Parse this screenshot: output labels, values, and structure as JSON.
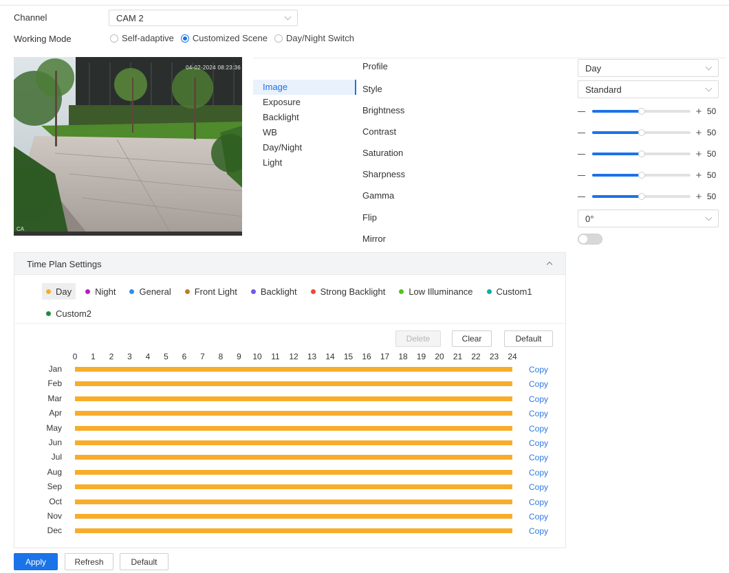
{
  "colors": {
    "accent": "#1a73e8",
    "link": "#2d78e0",
    "plan_bar": "#f7ad2b"
  },
  "channel": {
    "label": "Channel",
    "value": "CAM 2"
  },
  "working_mode": {
    "label": "Working Mode",
    "options": [
      {
        "label": "Self-adaptive",
        "selected": false
      },
      {
        "label": "Customized Scene",
        "selected": true
      },
      {
        "label": "Day/Night Switch",
        "selected": false
      }
    ]
  },
  "preview": {
    "timestamp": "04-02-2024 08:23:36",
    "corner": "CA"
  },
  "menu": {
    "items": [
      "Image",
      "Exposure",
      "Backlight",
      "WB",
      "Day/Night",
      "Light"
    ],
    "active_index": 0
  },
  "properties": {
    "profile": {
      "label": "Profile",
      "value": "Day"
    },
    "style": {
      "label": "Style",
      "value": "Standard"
    },
    "sliders": [
      {
        "label": "Brightness",
        "value": 50
      },
      {
        "label": "Contrast",
        "value": 50
      },
      {
        "label": "Saturation",
        "value": 50
      },
      {
        "label": "Sharpness",
        "value": 50
      },
      {
        "label": "Gamma",
        "value": 50
      }
    ],
    "slider_max": 100,
    "flip": {
      "label": "Flip",
      "value": "0°"
    },
    "mirror": {
      "label": "Mirror",
      "on": false
    }
  },
  "time_plan": {
    "title": "Time Plan Settings",
    "legend": [
      {
        "label": "Day",
        "color": "#f7ad2b",
        "active": true
      },
      {
        "label": "Night",
        "color": "#b21fbf",
        "active": false
      },
      {
        "label": "General",
        "color": "#2a8ff0",
        "active": false
      },
      {
        "label": "Front Light",
        "color": "#b8811c",
        "active": false
      },
      {
        "label": "Backlight",
        "color": "#6c5ce7",
        "active": false
      },
      {
        "label": "Strong Backlight",
        "color": "#ea4a34",
        "active": false
      },
      {
        "label": "Low Illuminance",
        "color": "#52c41a",
        "active": false
      },
      {
        "label": "Custom1",
        "color": "#13a8a8",
        "active": false
      },
      {
        "label": "Custom2",
        "color": "#1e8e3e",
        "active": false
      }
    ],
    "buttons": {
      "delete": "Delete",
      "clear": "Clear",
      "default": "Default"
    },
    "hours": [
      "0",
      "1",
      "2",
      "3",
      "4",
      "5",
      "6",
      "7",
      "8",
      "9",
      "10",
      "11",
      "12",
      "13",
      "14",
      "15",
      "16",
      "17",
      "18",
      "19",
      "20",
      "21",
      "22",
      "23",
      "24"
    ],
    "months": [
      "Jan",
      "Feb",
      "Mar",
      "Apr",
      "May",
      "Jun",
      "Jul",
      "Aug",
      "Sep",
      "Oct",
      "Nov",
      "Dec"
    ],
    "copy_label": "Copy",
    "schedule": "Day 0-24 for all months"
  },
  "footer": {
    "apply": "Apply",
    "refresh": "Refresh",
    "default": "Default"
  }
}
